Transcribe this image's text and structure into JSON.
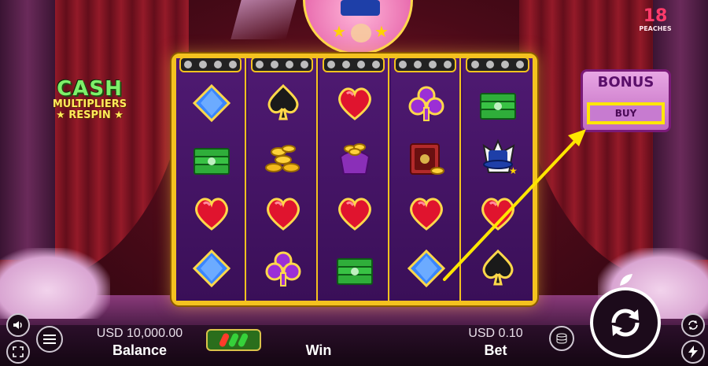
{
  "brand": {
    "number": "18",
    "name": "PEACHES"
  },
  "feature_logo": {
    "line1": "CASH",
    "line2": "MULTIPLIERS",
    "line3": "RESPIN"
  },
  "bonus": {
    "title": "BONUS",
    "buy_label": "BUY"
  },
  "bottom_bar": {
    "balance_value": "USD 10,000.00",
    "balance_label": "Balance",
    "win_label": "Win",
    "bet_value": "USD 0.10",
    "bet_label": "Bet"
  },
  "reels": [
    [
      "blue-diamond",
      "cash-stack",
      "red-heart",
      "blue-diamond"
    ],
    [
      "black-spade",
      "gold-coins",
      "red-heart",
      "purple-club"
    ],
    [
      "red-heart",
      "coin-purse",
      "red-heart",
      "cash-stack"
    ],
    [
      "purple-club",
      "treasure-safe",
      "red-heart",
      "blue-diamond"
    ],
    [
      "cash-stack",
      "magic-hat",
      "red-heart",
      "black-spade"
    ]
  ],
  "colors": {
    "reel_frame": "#f4c21f",
    "reel_bg": "#3f1160",
    "annotation_arrow": "#ffe600",
    "bonus_box": "#d98fd6"
  },
  "icons": {
    "sound": "speaker-icon",
    "fullscreen": "fullscreen-icon",
    "menu": "menu-icon",
    "bet_stack": "coin-stack-icon",
    "spin": "spin-arrows-icon",
    "autoplay": "autoplay-icon",
    "turbo": "lightning-icon"
  }
}
